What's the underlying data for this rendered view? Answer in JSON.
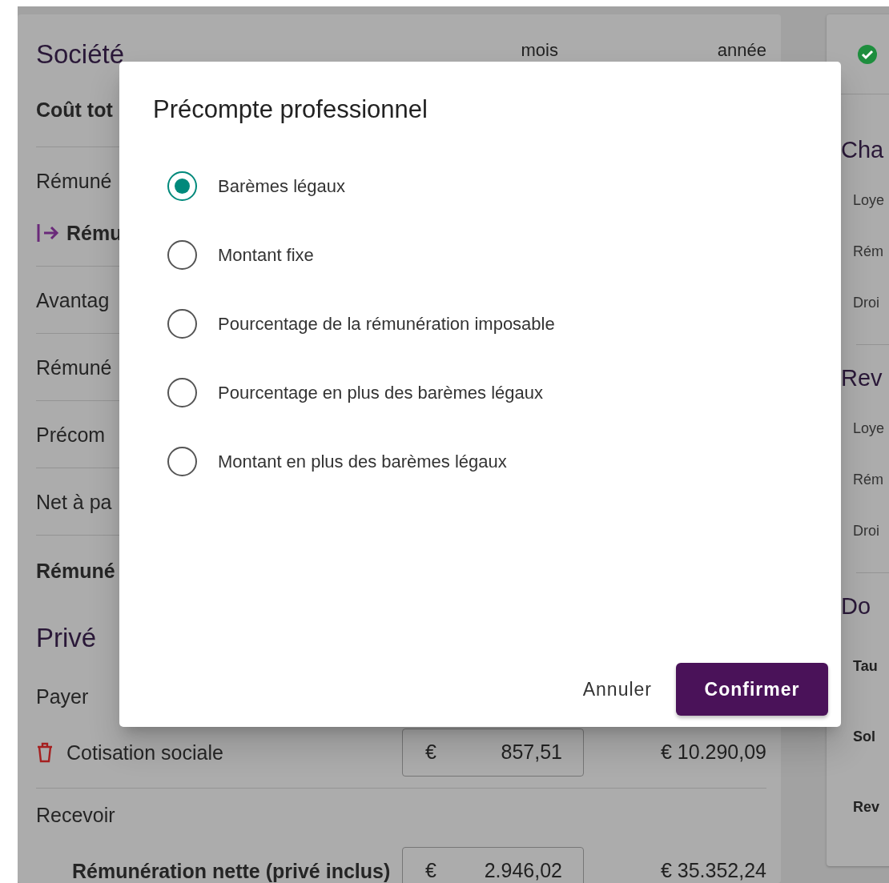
{
  "company_card": {
    "title": "Société",
    "columns": [
      "mois",
      "année"
    ],
    "sections": [
      {
        "rows": [
          {
            "kind": "bold",
            "label": "Coût tot"
          }
        ]
      },
      {
        "rows": [
          {
            "kind": "plain",
            "label": "Rémuné"
          },
          {
            "kind": "arrow",
            "label": "Rému"
          }
        ]
      },
      {
        "rows": [
          {
            "kind": "plain",
            "label": "Avantag"
          }
        ]
      },
      {
        "rows": [
          {
            "kind": "plain",
            "label": "Rémuné"
          }
        ]
      },
      {
        "rows": [
          {
            "kind": "plain",
            "label": "Précom"
          }
        ]
      },
      {
        "rows": [
          {
            "kind": "plain",
            "label": "Net à pa"
          }
        ]
      },
      {
        "rows": [
          {
            "kind": "bold",
            "label": "Rémuné"
          }
        ]
      }
    ]
  },
  "private_card": {
    "title": "Privé",
    "groups": [
      {
        "label": "Payer",
        "items": [
          {
            "kind": "delete",
            "label": "Cotisation sociale",
            "currency": "€",
            "month": "857,51",
            "year": "€ 10.290,09"
          }
        ]
      },
      {
        "label": "Recevoir",
        "items": [
          {
            "kind": "bold",
            "label": "Rémunération nette (privé inclus)",
            "currency": "€",
            "month": "2.946,02",
            "year": "€ 35.352,24"
          }
        ]
      }
    ]
  },
  "side_card": {
    "sections": [
      {
        "title": "Cha",
        "items": [
          {
            "kind": "plain",
            "label": "Loye"
          },
          {
            "kind": "plain",
            "label": "Rém"
          },
          {
            "kind": "plain",
            "label": "Droi"
          }
        ]
      },
      {
        "title": "Rev",
        "items": [
          {
            "kind": "plain",
            "label": "Loye"
          },
          {
            "kind": "plain",
            "label": "Rém"
          },
          {
            "kind": "plain",
            "label": "Droi"
          }
        ]
      },
      {
        "title": "Do",
        "items": [
          {
            "kind": "bold",
            "label": "Tau"
          },
          {
            "kind": "bold",
            "label": "Sol"
          },
          {
            "kind": "bold",
            "label": "Rev"
          }
        ]
      }
    ]
  },
  "dialog": {
    "title": "Précompte professionnel",
    "options": [
      {
        "label": "Barèmes légaux",
        "selected": true
      },
      {
        "label": "Montant fixe",
        "selected": false
      },
      {
        "label": "Pourcentage de la rémunération imposable",
        "selected": false
      },
      {
        "label": "Pourcentage en plus des barèmes légaux",
        "selected": false
      },
      {
        "label": "Montant en plus des barèmes légaux",
        "selected": false
      }
    ],
    "buttons": [
      {
        "kind": "text",
        "label": "Annuler"
      },
      {
        "kind": "primary",
        "label": "Confirmer"
      }
    ]
  }
}
